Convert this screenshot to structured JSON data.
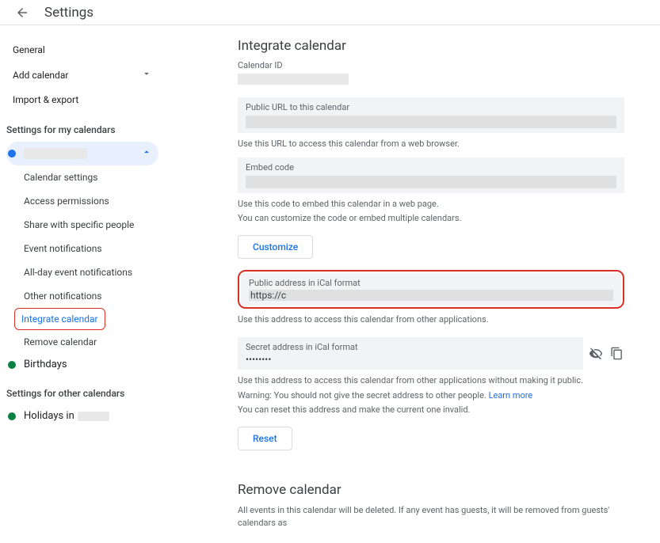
{
  "header": {
    "title": "Settings"
  },
  "sidebar": {
    "general": "General",
    "add_calendar": "Add calendar",
    "import_export": "Import & export",
    "settings_my": "Settings for my calendars",
    "settings_other": "Settings for other calendars",
    "birthdays": "Birthdays",
    "holidays": "Holidays in",
    "sub": {
      "calendar_settings": "Calendar settings",
      "access_permissions": "Access permissions",
      "share": "Share with specific people",
      "event_notifications": "Event notifications",
      "allday_notifications": "All-day event notifications",
      "other_notifications": "Other notifications",
      "integrate": "Integrate calendar",
      "remove": "Remove calendar"
    }
  },
  "main": {
    "integrate_title": "Integrate calendar",
    "calendar_id_label": "Calendar ID",
    "public_url_label": "Public URL to this calendar",
    "public_url_help": "Use this URL to access this calendar from a web browser.",
    "embed_label": "Embed code",
    "embed_help1": "Use this code to embed this calendar in a web page.",
    "embed_help2": "You can customize the code or embed multiple calendars.",
    "customize_btn": "Customize",
    "ical_public_label": "Public address in iCal format",
    "ical_public_value": "https://c",
    "ical_public_help": "Use this address to access this calendar from other applications.",
    "ical_secret_label": "Secret address in iCal format",
    "ical_secret_value": "••••••••",
    "ical_secret_help1": "Use this address to access this calendar from other applications without making it public.",
    "ical_secret_help2a": "Warning: You should not give the secret address to other people. ",
    "ical_secret_help2b": "Learn more",
    "ical_secret_help3": "You can reset this address and make the current one invalid.",
    "reset_btn": "Reset",
    "remove_title": "Remove calendar",
    "remove_help": "All events in this calendar will be deleted. If any event has guests, it will be removed from guests' calendars as"
  }
}
